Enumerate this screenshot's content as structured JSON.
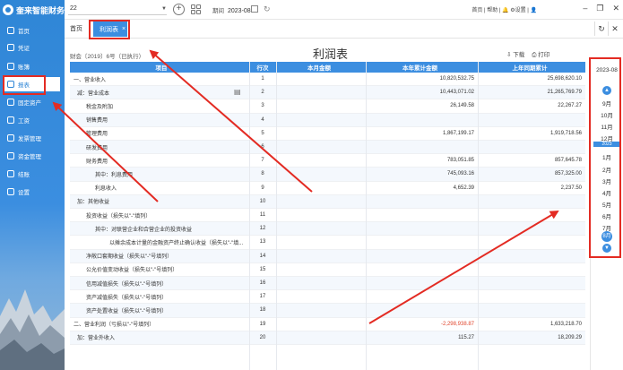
{
  "app": {
    "logo_text": "奎来智能财务"
  },
  "sidebar": {
    "items": [
      {
        "label": "首页"
      },
      {
        "label": "凭证"
      },
      {
        "label": "账簿"
      },
      {
        "label": "报表"
      },
      {
        "label": "固定资产"
      },
      {
        "label": "工资"
      },
      {
        "label": "发票管理"
      },
      {
        "label": "资金管理"
      },
      {
        "label": "结账"
      },
      {
        "label": "设置"
      }
    ]
  },
  "topbar": {
    "account": "22",
    "period_label": "期间",
    "period_value": "2023-08",
    "links": "首页 | 帮助 | 🔔 ⚙设置 | 👤"
  },
  "tabs": {
    "home": "首页",
    "active": "利润表"
  },
  "report": {
    "title": "利润表",
    "subtitle": "财会〔2019〕6号（已执行）",
    "download": "下载",
    "print": "打印",
    "columns": {
      "name": "项目",
      "no": "行次",
      "month": "本月金额",
      "ytd": "本年累计金额",
      "prev": "上年同期累计"
    },
    "rows": [
      {
        "name": "一、营业收入",
        "no": "1",
        "month": "",
        "ytd": "10,820,532.75",
        "prev": "25,698,620.10"
      },
      {
        "name": "减：营业成本",
        "no": "2",
        "month": "",
        "ytd": "10,443,071.02",
        "prev": "21,265,769.79"
      },
      {
        "name": "税金及附加",
        "no": "3",
        "month": "",
        "ytd": "26,149.58",
        "prev": "22,267.27"
      },
      {
        "name": "销售费用",
        "no": "4",
        "month": "",
        "ytd": "",
        "prev": ""
      },
      {
        "name": "管理费用",
        "no": "5",
        "month": "",
        "ytd": "1,867,199.17",
        "prev": "1,919,718.56"
      },
      {
        "name": "研发费用",
        "no": "6",
        "month": "",
        "ytd": "",
        "prev": ""
      },
      {
        "name": "财务费用",
        "no": "7",
        "month": "",
        "ytd": "783,051.85",
        "prev": "857,645.78"
      },
      {
        "name": "其中：利息费用",
        "no": "8",
        "month": "",
        "ytd": "745,093.16",
        "prev": "857,325.00"
      },
      {
        "name": "利息收入",
        "no": "9",
        "month": "",
        "ytd": "4,652.39",
        "prev": "2,237.50"
      },
      {
        "name": "加：其他收益",
        "no": "10",
        "month": "",
        "ytd": "",
        "prev": ""
      },
      {
        "name": "投资收益（损失以\"-\"填列）",
        "no": "11",
        "month": "",
        "ytd": "",
        "prev": ""
      },
      {
        "name": "其中：对联营企业和合营企业的投资收益",
        "no": "12",
        "month": "",
        "ytd": "",
        "prev": ""
      },
      {
        "name": "以摊余成本计量的金融资产终止确认收益（损失以\"-\"填...",
        "no": "13",
        "month": "",
        "ytd": "",
        "prev": ""
      },
      {
        "name": "净敞口套期收益（损失以\"-\"号填列）",
        "no": "14",
        "month": "",
        "ytd": "",
        "prev": ""
      },
      {
        "name": "公允价值变动收益（损失以\"-\"号填列）",
        "no": "15",
        "month": "",
        "ytd": "",
        "prev": ""
      },
      {
        "name": "信用减值损失（损失以\"-\"号填列）",
        "no": "16",
        "month": "",
        "ytd": "",
        "prev": ""
      },
      {
        "name": "资产减值损失（损失以\"-\"号填列）",
        "no": "17",
        "month": "",
        "ytd": "",
        "prev": ""
      },
      {
        "name": "资产处置收益（损失以\"-\"号填列）",
        "no": "18",
        "month": "",
        "ytd": "",
        "prev": ""
      },
      {
        "name": "二、营业利润（亏损以\"-\"号填列）",
        "no": "19",
        "month": "",
        "ytd": "-2,298,938.87",
        "prev": "1,633,218.70"
      },
      {
        "name": "加：营业外收入",
        "no": "20",
        "month": "",
        "ytd": "115.27",
        "prev": "18,209.29"
      }
    ]
  },
  "period_pane": {
    "year": "2023-08",
    "months": [
      "9月",
      "10月",
      "11月",
      "12月",
      "1月",
      "2月",
      "3月",
      "4月",
      "5月",
      "6月",
      "7月",
      "8月"
    ],
    "year_mark": "2023",
    "selected": "8月"
  },
  "colors": {
    "accent": "#3c8ee0",
    "annotation": "#e32b23",
    "negative": "#e0452c"
  }
}
